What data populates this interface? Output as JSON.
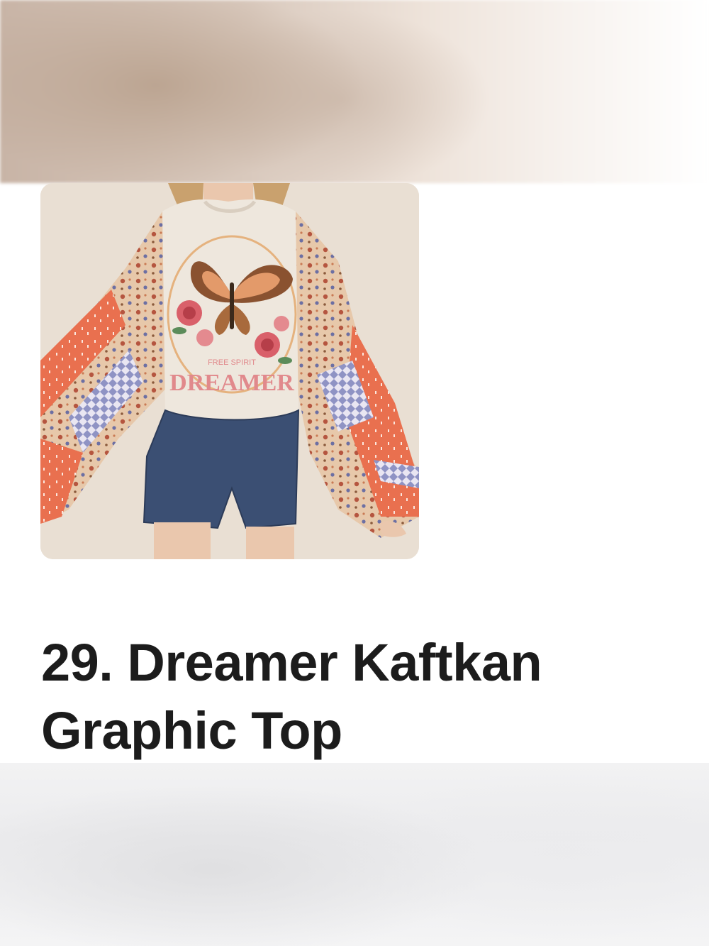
{
  "product": {
    "title_line1": "29. Dreamer Kaftkan",
    "title_line2": "Graphic Top",
    "print_text_small": "FREE SPIRIT",
    "print_text_large": "DREAMER"
  },
  "colors": {
    "background": "#ffffff",
    "title_text": "#1c1c1c",
    "sleeve_orange": "#e9704f",
    "shirt_cream": "#eee7dd",
    "denim": "#3b4f73"
  },
  "icons": {
    "butterfly": "butterfly-graphic",
    "roses": "rose-graphic"
  }
}
